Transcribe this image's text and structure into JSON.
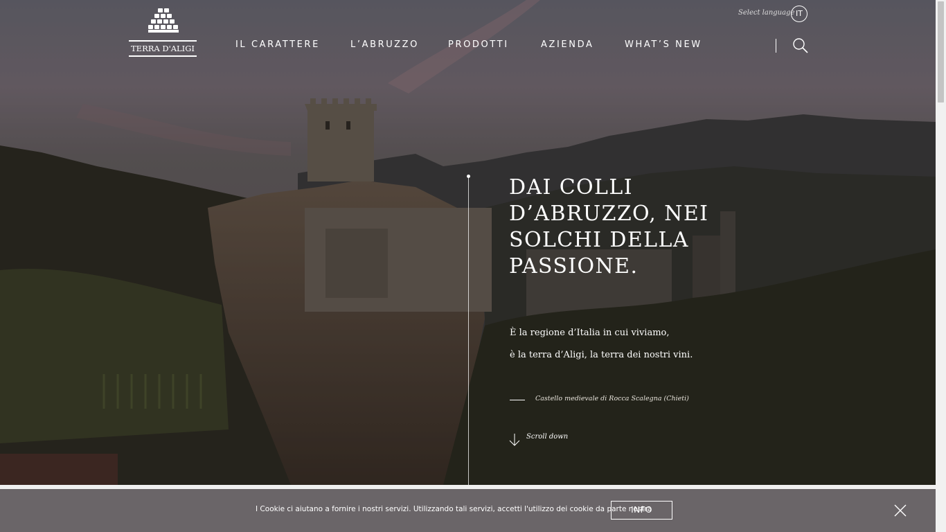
{
  "header": {
    "logo_text": "TERRA D'ALIGI",
    "nav": [
      {
        "label": "IL CARATTERE"
      },
      {
        "label": "L’ABRUZZO"
      },
      {
        "label": "PRODOTTI"
      },
      {
        "label": "AZIENDA"
      },
      {
        "label": "WHAT’S NEW"
      }
    ],
    "language_label": "Select language",
    "language_code": "IT",
    "search_icon": "search-icon"
  },
  "hero": {
    "headline_lines": [
      "DAI COLLI",
      "D’ABRUZZO, NEI",
      "SOLCHI DELLA",
      "PASSIONE."
    ],
    "intro_lines": [
      "È la regione d’Italia in cui viviamo,",
      "è la terra d’Aligi, la terra dei nostri vini."
    ],
    "caption": "Castello medievale di Rocca Scalegna (Chieti)",
    "scroll_label": "Scroll down"
  },
  "cookie": {
    "text": "I Cookie ci aiutano a fornire i nostri servizi. Utilizzando tali servizi, accetti l'utilizzo dei cookie da parte nostra",
    "info_label": "INFO",
    "close_icon": "close-icon"
  }
}
